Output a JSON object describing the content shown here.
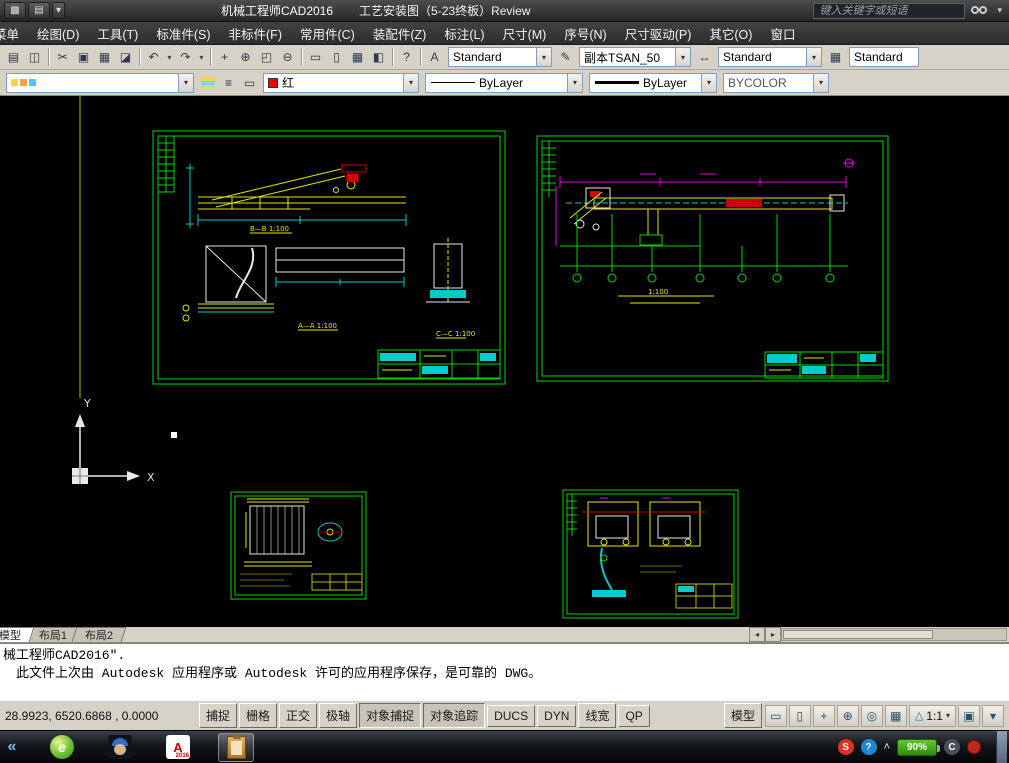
{
  "titlebar": {
    "app_title": "机械工程师CAD2016",
    "doc_title": "工艺安装图（5-23终板）Review",
    "search_placeholder": "键入关键字或短语"
  },
  "menu": {
    "items": [
      "菜单",
      "绘图(D)",
      "工具(T)",
      "标准件(S)",
      "非标件(F)",
      "常用件(C)",
      "装配件(Z)",
      "标注(L)",
      "尺寸(M)",
      "序号(N)",
      "尺寸驱动(P)",
      "其它(O)",
      "窗口"
    ]
  },
  "toolbar": {
    "text_style_label": "Standard",
    "font_style_label": "副本TSAN_50",
    "dim_style_label": "Standard",
    "table_style_label": "Standard"
  },
  "properties": {
    "layer_value": "",
    "color_value": "红",
    "color_hex": "#ff0000",
    "linetype_value": "ByLayer",
    "lineweight_value": "ByLayer",
    "plotstyle_value": "BYCOLOR"
  },
  "canvas": {
    "labels": {
      "section_bb": "B—B 1:100",
      "section_aa": "A—A 1:100",
      "section_cc": "C—C 1:100",
      "sheet2_scale": "1:100",
      "axis_x": "X",
      "axis_y": "Y"
    },
    "frame_color": "#00d200",
    "entity_colors": {
      "yellow": "#e6e600",
      "cyan": "#00cccc",
      "red": "#cc0000",
      "magenta": "#e600e6",
      "white": "#e8e8e8"
    }
  },
  "tabs": {
    "items": [
      "模型",
      "布局1",
      "布局2"
    ]
  },
  "command": {
    "line1": "械工程师CAD2016\".",
    "line2": "此文件上次由 Autodesk 应用程序或 Autodesk 许可的应用程序保存，是可靠的 DWG。"
  },
  "statusbar": {
    "coordinates": "28.9923, 6520.6868 , 0.0000",
    "toggles": [
      {
        "label": "捕捉",
        "pressed": false
      },
      {
        "label": "栅格",
        "pressed": false
      },
      {
        "label": "正交",
        "pressed": false
      },
      {
        "label": "极轴",
        "pressed": false
      },
      {
        "label": "对象捕捉",
        "pressed": true
      },
      {
        "label": "对象追踪",
        "pressed": true
      },
      {
        "label": "DUCS",
        "pressed": false
      },
      {
        "label": "DYN",
        "pressed": false
      },
      {
        "label": "线宽",
        "pressed": false
      },
      {
        "label": "QP",
        "pressed": false
      }
    ],
    "model_label": "模型",
    "annotation_scale": "1:1"
  },
  "taskbar": {
    "battery_label": "90%"
  },
  "glyphs": {
    "app_menu": "▩",
    "print": "▤",
    "preview": "◫",
    "dropdown": "▾",
    "cut": "✂",
    "copy": "▣",
    "paste": "▦",
    "painter": "◪",
    "undo": "↶",
    "redo": "↷",
    "pan": "+",
    "zoom_rt": "⊕",
    "zoom_win": "◰",
    "zoom_prev": "⊖",
    "sheet": "▭",
    "sheet2": "▯",
    "table": "▦",
    "extra": "◧",
    "help": "?",
    "text_style": "A",
    "pencil": "✎",
    "dim": "↔",
    "layer_tool": "≡",
    "tab_left": "◂",
    "tab_right": "▸",
    "qv_layouts": "▭",
    "qv_drawings": "▯",
    "steering": "◎",
    "showmotion": "▦",
    "scale_tri": "△",
    "annot_vis": "▣",
    "caret_up": "˄",
    "start": "«",
    "e_browser": "e",
    "acad_a": "A",
    "acad_year": "2016",
    "s_tray": "S",
    "q_tray": "?",
    "c_tray": "C"
  }
}
